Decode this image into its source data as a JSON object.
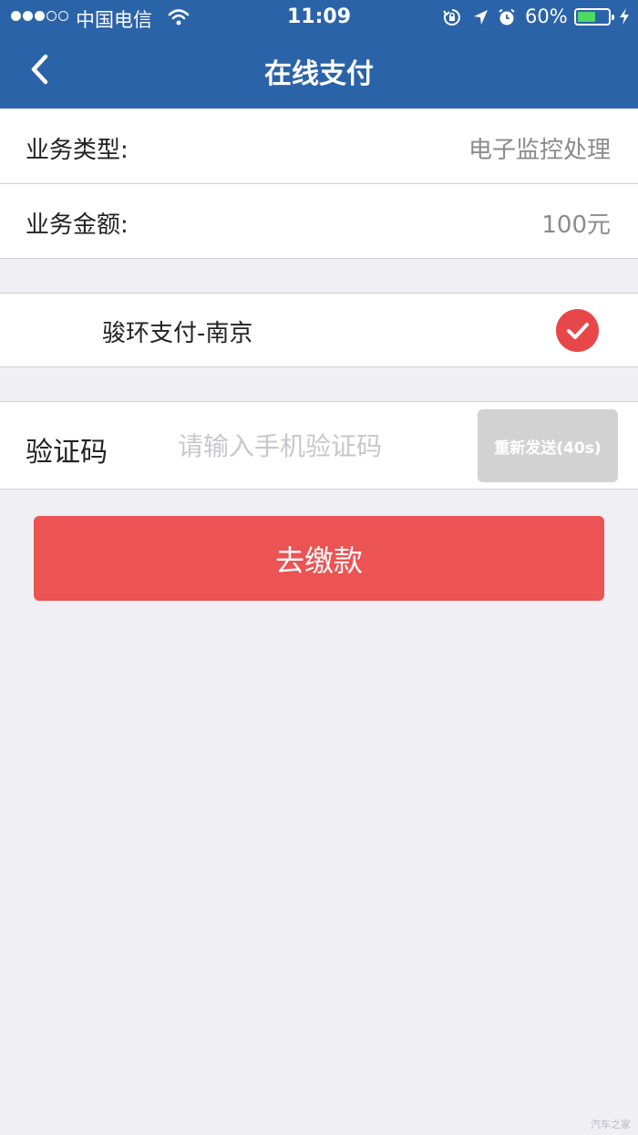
{
  "status_bar": {
    "carrier": "中国电信",
    "time": "11:09",
    "battery_percent": "60%",
    "battery_level": 0.6,
    "icons": [
      "signal-dots",
      "wifi-icon",
      "orientation-lock-icon",
      "location-icon",
      "alarm-icon",
      "battery-icon",
      "charging-bolt-icon"
    ]
  },
  "nav": {
    "title": "在线支付",
    "back_icon": "chevron-left-icon"
  },
  "colors": {
    "header": "#2b63a9",
    "accent_red": "#ec5353",
    "check_red": "#e8474a",
    "background": "#efeff4"
  },
  "business": {
    "type_label": "业务类型:",
    "type_value": "电子监控处理",
    "amount_label": "业务金额:",
    "amount_value": "100元"
  },
  "payment": {
    "method": "骏环支付-南京",
    "selected": true
  },
  "verification": {
    "label": "验证码",
    "placeholder": "请输入手机验证码",
    "value": "",
    "resend_label": "重新发送(40s)"
  },
  "submit_label": "去缴款",
  "watermark": "汽车之家"
}
